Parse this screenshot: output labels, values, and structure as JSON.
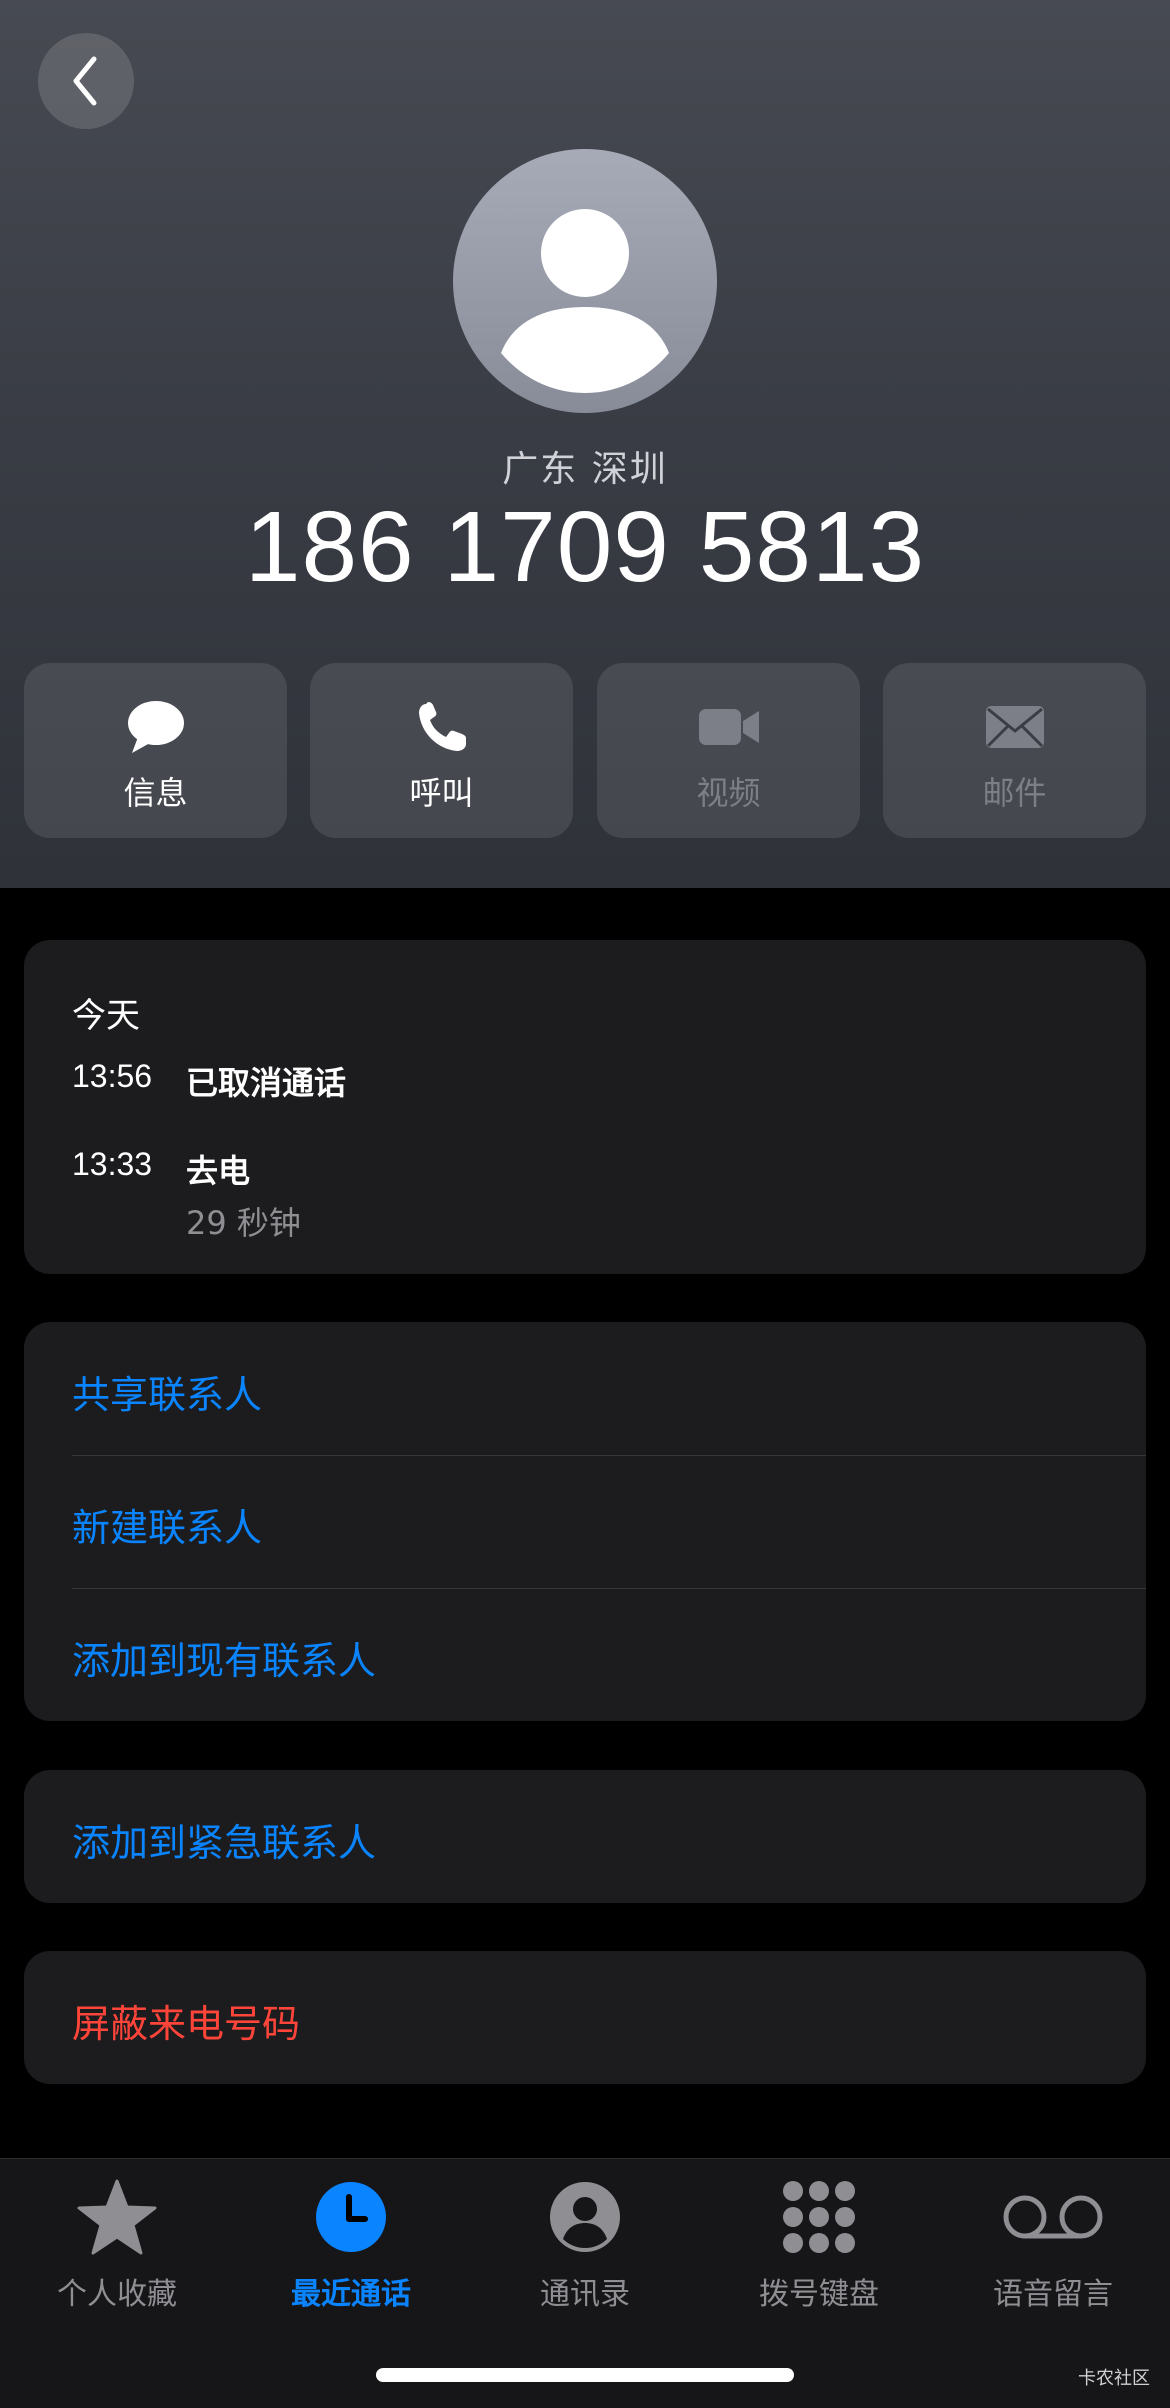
{
  "contact": {
    "location": "广东 深圳",
    "phone_number": "186 1709 5813"
  },
  "actions": [
    {
      "label": "信息",
      "icon": "message-bubble-icon",
      "enabled": true
    },
    {
      "label": "呼叫",
      "icon": "phone-icon",
      "enabled": true
    },
    {
      "label": "视频",
      "icon": "video-camera-icon",
      "enabled": false
    },
    {
      "label": "邮件",
      "icon": "envelope-icon",
      "enabled": false
    }
  ],
  "history": {
    "day": "今天",
    "entries": [
      {
        "time": "13:56",
        "type": "已取消通话",
        "duration": ""
      },
      {
        "time": "13:33",
        "type": "去电",
        "duration": "29 秒钟"
      }
    ]
  },
  "contact_options": [
    "共享联系人",
    "新建联系人",
    "添加到现有联系人"
  ],
  "emergency_option": "添加到紧急联系人",
  "block_option": "屏蔽来电号码",
  "tabs": [
    {
      "label": "个人收藏",
      "icon": "star-icon",
      "active": false
    },
    {
      "label": "最近通话",
      "icon": "clock-icon",
      "active": true
    },
    {
      "label": "通讯录",
      "icon": "person-circle-icon",
      "active": false
    },
    {
      "label": "拨号键盘",
      "icon": "keypad-icon",
      "active": false
    },
    {
      "label": "语音留言",
      "icon": "voicemail-icon",
      "active": false
    }
  ],
  "watermark": "卡农社区",
  "colors": {
    "accent": "#0a84ff",
    "destructive": "#ff453a",
    "card_bg": "#1c1c1e",
    "secondary_text": "#8e8e93"
  }
}
